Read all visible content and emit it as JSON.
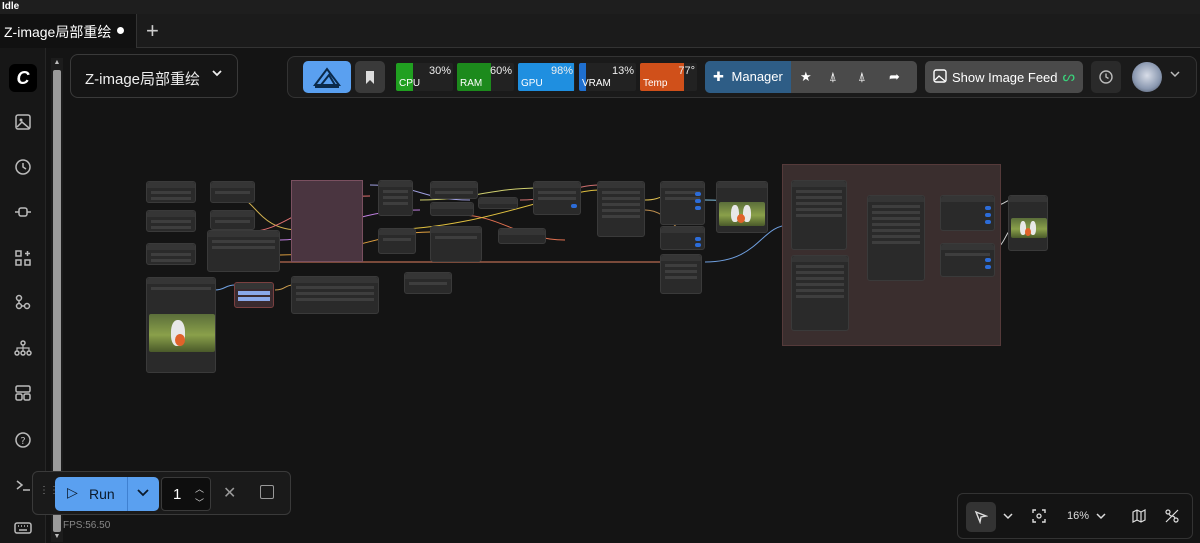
{
  "window": {
    "status_title": "Idle"
  },
  "tabs": [
    {
      "label": "Z-image局部重绘",
      "modified": true
    }
  ],
  "new_tab_icon": "plus-icon",
  "workflow_select": {
    "value": "Z-image局部重绘"
  },
  "sidebar": {
    "items": [
      "logo-icon",
      "images-icon",
      "history-icon",
      "connect-icon",
      "nodes-icon",
      "model-icon",
      "workflow-icon",
      "templates-icon",
      "help-icon",
      "terminal-icon",
      "keyboard-icon"
    ]
  },
  "monitor": {
    "cpu": {
      "label": "CPU",
      "value": "30%",
      "fraction": 0.3,
      "color": "#20a020"
    },
    "ram": {
      "label": "RAM",
      "value": "60%",
      "fraction": 0.6,
      "color": "#1c8a1c"
    },
    "gpu": {
      "label": "GPU",
      "value": "98%",
      "fraction": 0.98,
      "color": "#1f8fe0"
    },
    "vram": {
      "label": "VRAM",
      "value": "13%",
      "fraction": 0.13,
      "color": "#1f6fcf"
    },
    "temp": {
      "label": "Temp",
      "value": "77°",
      "fraction": 0.77,
      "color": "#d0501a"
    }
  },
  "manager": {
    "label": "Manager"
  },
  "feed": {
    "label": "Show Image Feed"
  },
  "run": {
    "label": "Run",
    "count": "1"
  },
  "zoom": {
    "value": "16%"
  },
  "fps": {
    "value": "FPS:56.50"
  }
}
